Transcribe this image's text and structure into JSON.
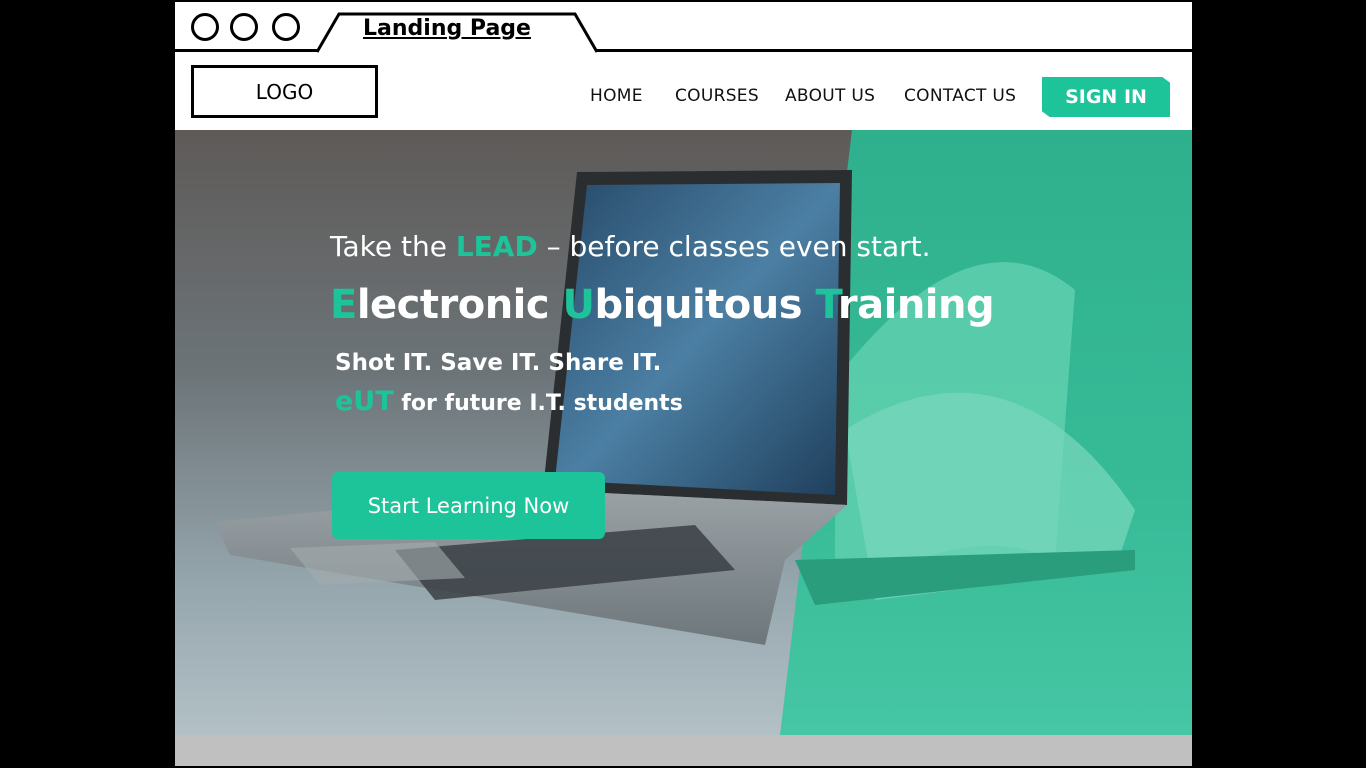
{
  "browser": {
    "tab_title": "Landing Page"
  },
  "nav": {
    "logo": "LOGO",
    "links": [
      "HOME",
      "COURSES",
      "ABOUT US",
      "CONTACT US"
    ],
    "signin": "SIGN IN"
  },
  "hero": {
    "tagline_pre": "Take the ",
    "tagline_accent": "LEAD",
    "tagline_post": " – before classes even start.",
    "headline": [
      {
        "accent": "E",
        "rest": "lectronic "
      },
      {
        "accent": "U",
        "rest": "biquitous "
      },
      {
        "accent": "T",
        "rest": "raining"
      }
    ],
    "sub1": "Shot IT. Save IT. Share IT.",
    "sub2_accent": "eUT",
    "sub2_rest": " for future I.T. students",
    "cta": "Start Learning Now",
    "image_alt": "laptop-and-open-book-photo"
  },
  "colors": {
    "accent": "#1dc49a",
    "accent_dark": "#17a884",
    "hero_green": "#3cc09c"
  }
}
